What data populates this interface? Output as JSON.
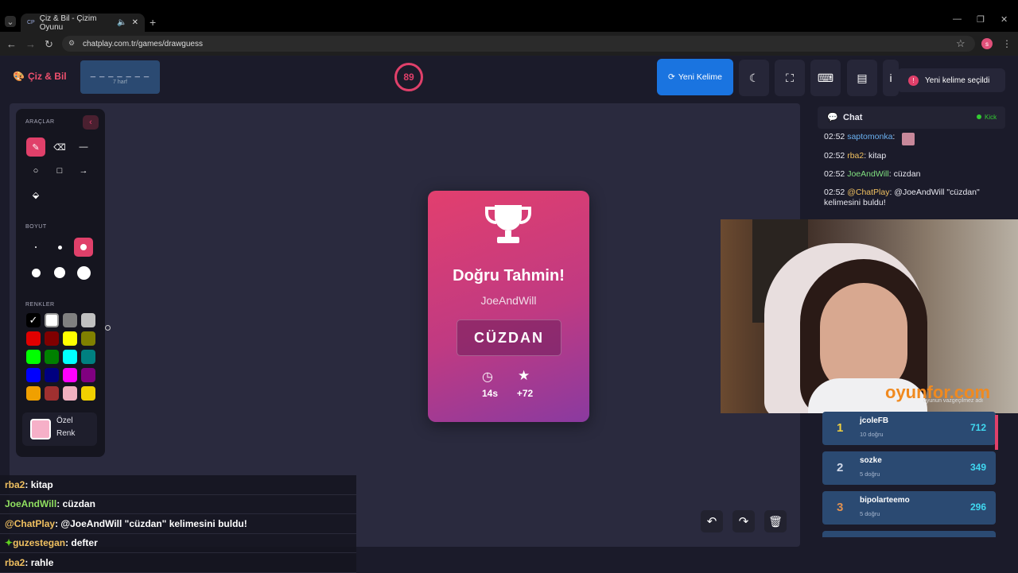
{
  "browser": {
    "tab_title": "Çiz & Bil - Çizim Oyunu",
    "tab_favicon": "CP",
    "url": "chatplay.com.tr/games/drawguess",
    "profile_initial": "s"
  },
  "header": {
    "logo": "Çiz & Bil",
    "word_mask": "_ _ _ _ _ _ _",
    "word_hint": "7 harf",
    "timer": "89",
    "new_word_label": "Yeni Kelime",
    "toast": "Yeni kelime seçildi"
  },
  "tools": {
    "section_tools": "ARAÇLAR",
    "section_size": "BOYUT",
    "section_colors": "RENKLER",
    "custom_color_label_1": "Özel",
    "custom_color_label_2": "Renk",
    "custom_color": "#f6b0c8",
    "colors": [
      "#000000",
      "#ffffff",
      "#808080",
      "#c0c0c0",
      "#e00000",
      "#800000",
      "#ffff00",
      "#808000",
      "#00ff00",
      "#008000",
      "#00ffff",
      "#008080",
      "#0000ff",
      "#000080",
      "#ff00ff",
      "#800080",
      "#f0a000",
      "#a03030",
      "#f0b0c0",
      "#f0d000"
    ]
  },
  "card": {
    "title": "Doğru Tahmin!",
    "player": "JoeAndWill",
    "word": "CÜZDAN",
    "time": "14s",
    "points": "+72"
  },
  "chat": {
    "title": "Chat",
    "status": "Kick",
    "messages": [
      {
        "time": "02:52",
        "user": "saptomonka",
        "text": ":",
        "user_color": "#6ab0f0"
      },
      {
        "time": "02:52",
        "user": "rba2",
        "text": ": kitap",
        "user_color": "#f0c060"
      },
      {
        "time": "02:52",
        "user": "JoeAndWill",
        "text": ": cüzdan",
        "user_color": "#80e080"
      },
      {
        "time": "02:52",
        "user": "@ChatPlay",
        "text": ": @JoeAndWill \"cüzdan\" kelimesini buldu!",
        "user_color": "#f0c060"
      }
    ]
  },
  "watermark": "oyunfor.com",
  "watermark_sub": "oyunun vazgeçilmez adı",
  "scoreboard": [
    {
      "rank": "1",
      "name": "jcoleFB",
      "sub": "10 doğru",
      "score": "712"
    },
    {
      "rank": "2",
      "name": "sozke",
      "sub": "5 doğru",
      "score": "349"
    },
    {
      "rank": "3",
      "name": "bipolarteemo",
      "sub": "5 doğru",
      "score": "296"
    }
  ],
  "overlay_chat": [
    {
      "user": "rba2",
      "text": ": kitap",
      "color": "#f0c060"
    },
    {
      "user": "JoeAndWill",
      "text": ": cüzdan",
      "color": "#90e060"
    },
    {
      "user": "@ChatPlay",
      "text": ": @JoeAndWill \"cüzdan\" kelimesini buldu!",
      "color": "#f0c060"
    },
    {
      "user": "guzestegan",
      "text": ": defter",
      "color": "#f0c060"
    },
    {
      "user": "rba2",
      "text": ": rahle",
      "color": "#f0c060"
    }
  ]
}
